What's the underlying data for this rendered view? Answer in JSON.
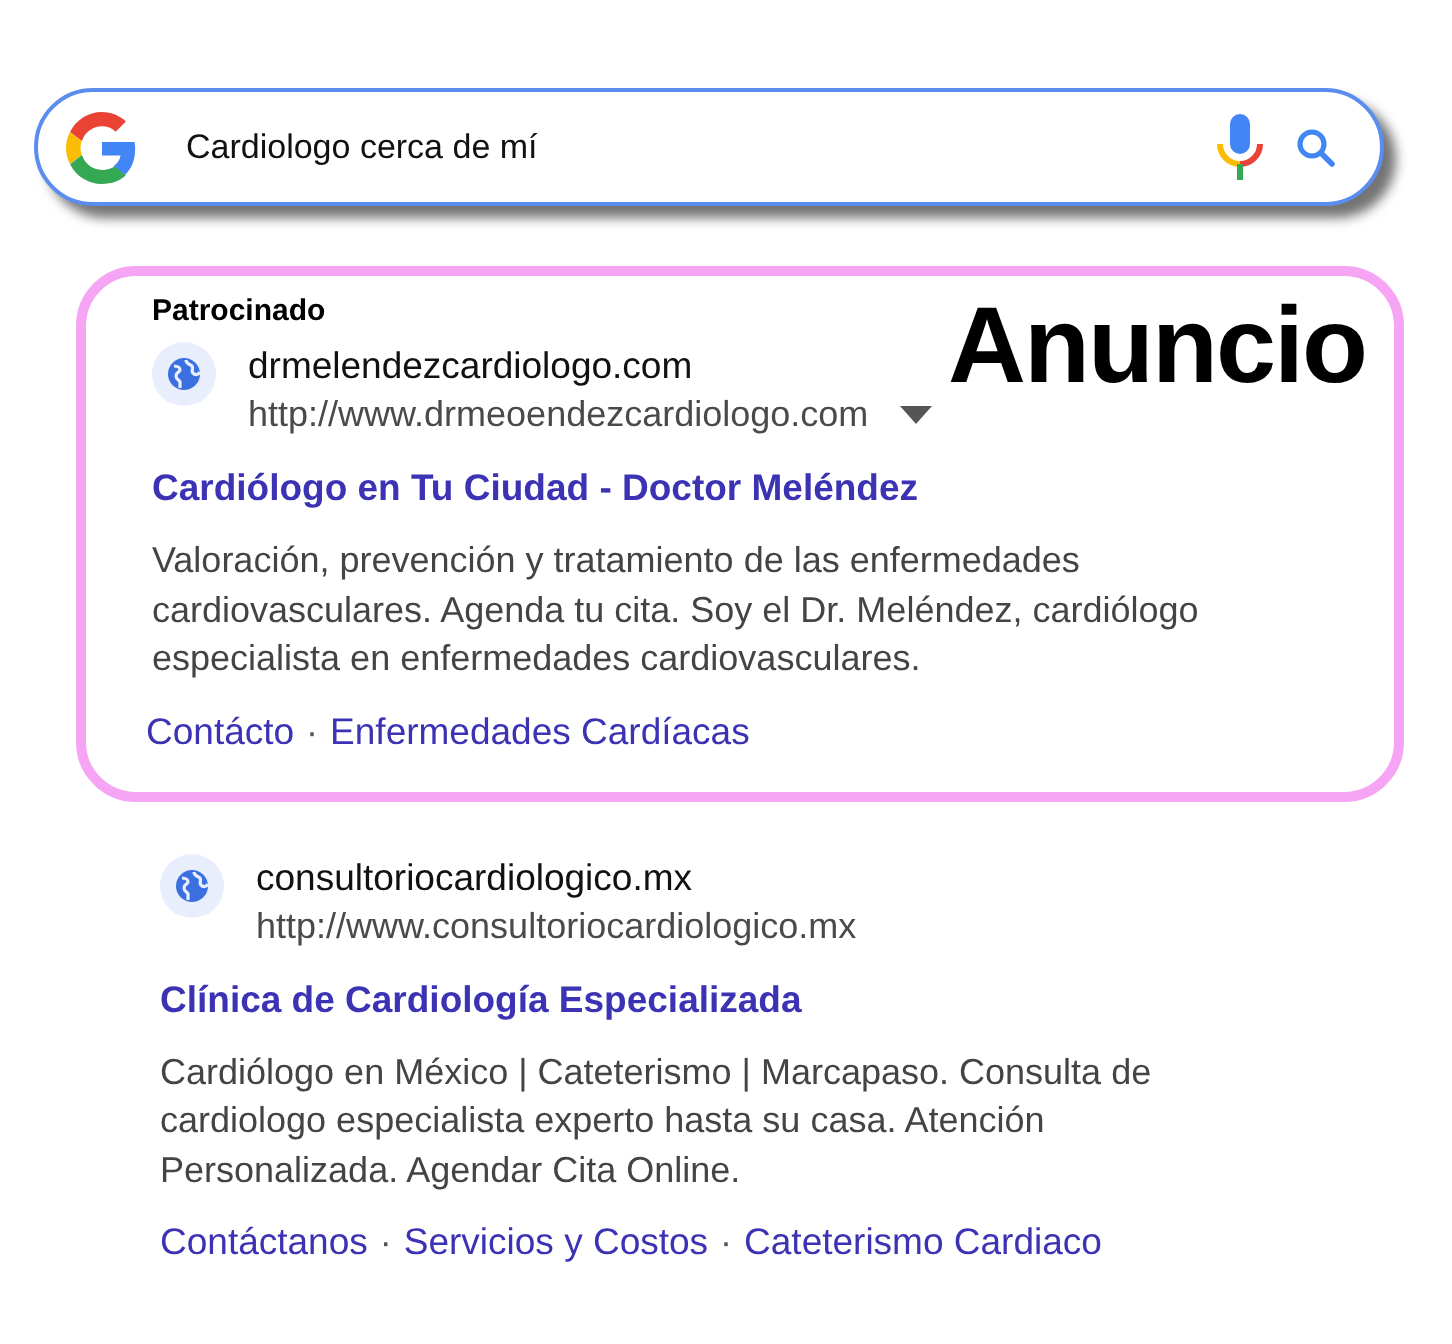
{
  "search": {
    "value": "Cardiologo cerca de mí"
  },
  "results": [
    {
      "kind": "ad",
      "sponsored_label": "Patrocinado",
      "annotation": "Anuncio",
      "domain": "drmelendezcardiologo.com",
      "url": "http://www.drmeoendezcardiologo.com",
      "title": "Cardiólogo en Tu Ciudad - Doctor Meléndez",
      "description": "Valoración, prevención y tratamiento de las enfermedades cardiovasculares. Agenda tu cita. Soy el Dr. Meléndez, cardiólogo especialista en enfermedades cardiovasculares.",
      "sitelinks": [
        {
          "kind": "link",
          "text": "Contácto"
        },
        {
          "kind": "separator",
          "text": "·"
        },
        {
          "kind": "link",
          "text": "Enfermedades Cardíacas"
        }
      ]
    },
    {
      "kind": "organic",
      "domain": "consultoriocardiologico.mx",
      "url": "http://www.consultoriocardiologico.mx",
      "title": "Clínica de Cardiología Especializada",
      "description": "Cardiólogo en México | Cateterismo | Marcapaso. Consulta de cardiologo especialista experto hasta su casa. Atención Personalizada. Agendar Cita Online.",
      "sitelinks": [
        {
          "kind": "link",
          "text": "Contáctanos"
        },
        {
          "kind": "separator",
          "text": "·"
        },
        {
          "kind": "link",
          "text": "Servicios y Costos"
        },
        {
          "kind": "separator",
          "text": "·"
        },
        {
          "kind": "link",
          "text": "Cateterismo Cardiaco"
        }
      ]
    }
  ]
}
